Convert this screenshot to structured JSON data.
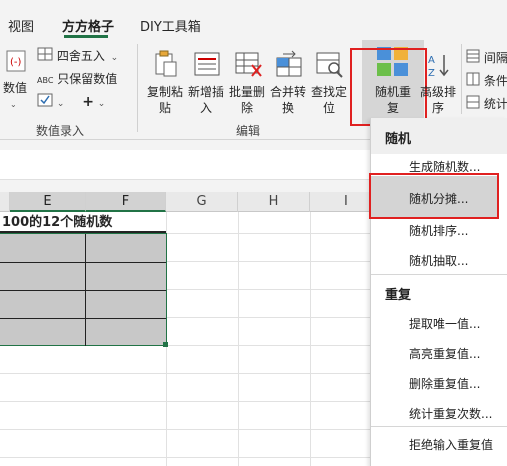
{
  "tabs": [
    {
      "label": "视图"
    },
    {
      "label": "方方格子"
    },
    {
      "label": "DIY工具箱"
    }
  ],
  "ribbon": {
    "numeric_entry": {
      "partial_button": "数值",
      "round_label": "四舍五入",
      "keep_values_label": "只保留数值",
      "group_label": "数值录入"
    },
    "edit": {
      "copy_paste": [
        "复制粘",
        "贴"
      ],
      "insert": [
        "新增插",
        "入"
      ],
      "batch_delete": [
        "批量删",
        "除"
      ],
      "merge_convert": [
        "合并转",
        "换"
      ],
      "find_locate": [
        "查找定",
        "位"
      ],
      "group_label": "编辑"
    },
    "random_repeat": [
      "随机重",
      "复"
    ],
    "advanced_sort": [
      "高级排",
      "序"
    ],
    "right_partial": [
      "间隔",
      "条件",
      "统计"
    ]
  },
  "grid": {
    "columns": [
      "E",
      "F",
      "G",
      "H",
      "I"
    ],
    "title_cell": "100的12个随机数"
  },
  "menu": {
    "section_random": "随机",
    "items_random": [
      "生成随机数...",
      "随机分摊...",
      "随机排序...",
      "随机抽取..."
    ],
    "section_repeat": "重复",
    "items_repeat": [
      "提取唯一值...",
      "高亮重复值...",
      "删除重复值...",
      "统计重复次数...",
      "拒绝输入重复值"
    ]
  },
  "colors": {
    "accent_green": "#217346",
    "highlight_red": "#e02020",
    "selected_fill": "#c8c8c8"
  }
}
